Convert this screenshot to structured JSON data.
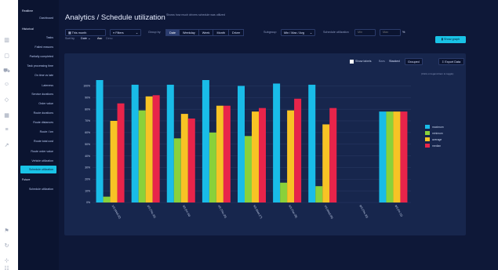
{
  "nav": {
    "items": [
      {
        "label": "Realtime",
        "kind": "section"
      },
      {
        "label": "Dashboard",
        "kind": "sub"
      },
      {
        "label": "Historical",
        "kind": "section"
      },
      {
        "label": "Tasks",
        "kind": "sub"
      },
      {
        "label": "Failed reasons",
        "kind": "sub"
      },
      {
        "label": "Partially completed",
        "kind": "sub"
      },
      {
        "label": "Task processing time",
        "kind": "sub"
      },
      {
        "label": "On time vs late",
        "kind": "sub"
      },
      {
        "label": "Lateness",
        "kind": "sub"
      },
      {
        "label": "Service durations",
        "kind": "sub"
      },
      {
        "label": "Order value",
        "kind": "sub"
      },
      {
        "label": "Route durations",
        "kind": "sub"
      },
      {
        "label": "Route distances",
        "kind": "sub"
      },
      {
        "label": "Route / km",
        "kind": "sub"
      },
      {
        "label": "Route total cost",
        "kind": "sub"
      },
      {
        "label": "Route order value",
        "kind": "sub"
      },
      {
        "label": "Vehicle utilization",
        "kind": "sub"
      },
      {
        "label": "Schedule utilization",
        "kind": "sub",
        "active": true
      },
      {
        "label": "Future",
        "kind": "section"
      },
      {
        "label": "Schedule utilization",
        "kind": "sub"
      }
    ]
  },
  "rail_icons": [
    "chart-icon",
    "box-icon",
    "truck-icon",
    "user-icon",
    "tag-icon",
    "grid-icon",
    "list-icon",
    "trend-icon",
    "flag-icon",
    "refresh-icon",
    "network-icon",
    "users-icon"
  ],
  "header": {
    "title": "Analytics / Schedule utilization",
    "subtitle": "Shows how much drivers schedule was utilized"
  },
  "toolbar": {
    "period": "This month",
    "filters": "Filters",
    "group_by_label": "Group by",
    "group_by_options": [
      "Date",
      "Weekday",
      "Week",
      "Month",
      "Driver"
    ],
    "group_by_selected": "Date",
    "subgroup_label": "Subgroup",
    "subgroup_value": "Min / Max / Avg",
    "schedule_util_label": "Schedule utilization",
    "min_placeholder": "Min",
    "max_placeholder": "Max",
    "percent": "%",
    "sort_label": "Sort by",
    "sort_field": "Date",
    "sort_asc": "Asc",
    "sort_desc": "Desc",
    "show_graph": "Show graph"
  },
  "chart_controls": {
    "show_labels": "Show labels",
    "bars_label": "Bars",
    "stacked": "Stacked",
    "grouped": "Grouped",
    "export": "Export Data",
    "hint": "(Click on legend item to toggle)"
  },
  "colors": {
    "maximum": "#19bce8",
    "minimum": "#8ad13a",
    "average": "#f7c325",
    "median": "#e8244a"
  },
  "chart_data": {
    "type": "bar",
    "categories": [
      "2023-03-01",
      "2023-03-02",
      "2023-03-03",
      "2023-03-04",
      "2023-03-05",
      "2023-03-06",
      "2023-03-07",
      "2023-03-08",
      "2023-03-09"
    ],
    "category_labels": [
      "1/3 (Wed 22)",
      "2/3 (Thu 23)",
      "3/3 (Fri 24)",
      "4/3 (Thu 25)",
      "5/3 (Mon 27)",
      "6/3 (Tue 28)",
      "7/3 (Wed 29)",
      "8/3 (Thu 30)",
      "9/3 (Fri 31)"
    ],
    "series": [
      {
        "name": "maximum",
        "values": [
          105,
          101,
          101,
          105,
          100,
          102,
          101,
          null,
          78
        ]
      },
      {
        "name": "minimum",
        "values": [
          5,
          79,
          55,
          60,
          57,
          17,
          14,
          null,
          78
        ]
      },
      {
        "name": "average",
        "values": [
          70,
          91,
          76,
          83,
          78,
          79,
          67,
          null,
          78
        ]
      },
      {
        "name": "median",
        "values": [
          85,
          92,
          72,
          83,
          81,
          89,
          81,
          null,
          78
        ]
      }
    ],
    "y_ticks": [
      "100%",
      "90%",
      "80%",
      "70%",
      "60%",
      "50%",
      "40%",
      "30%",
      "20%",
      "10%",
      "0%"
    ],
    "ylim": [
      0,
      105
    ],
    "grid": true,
    "legend_position": "right"
  }
}
